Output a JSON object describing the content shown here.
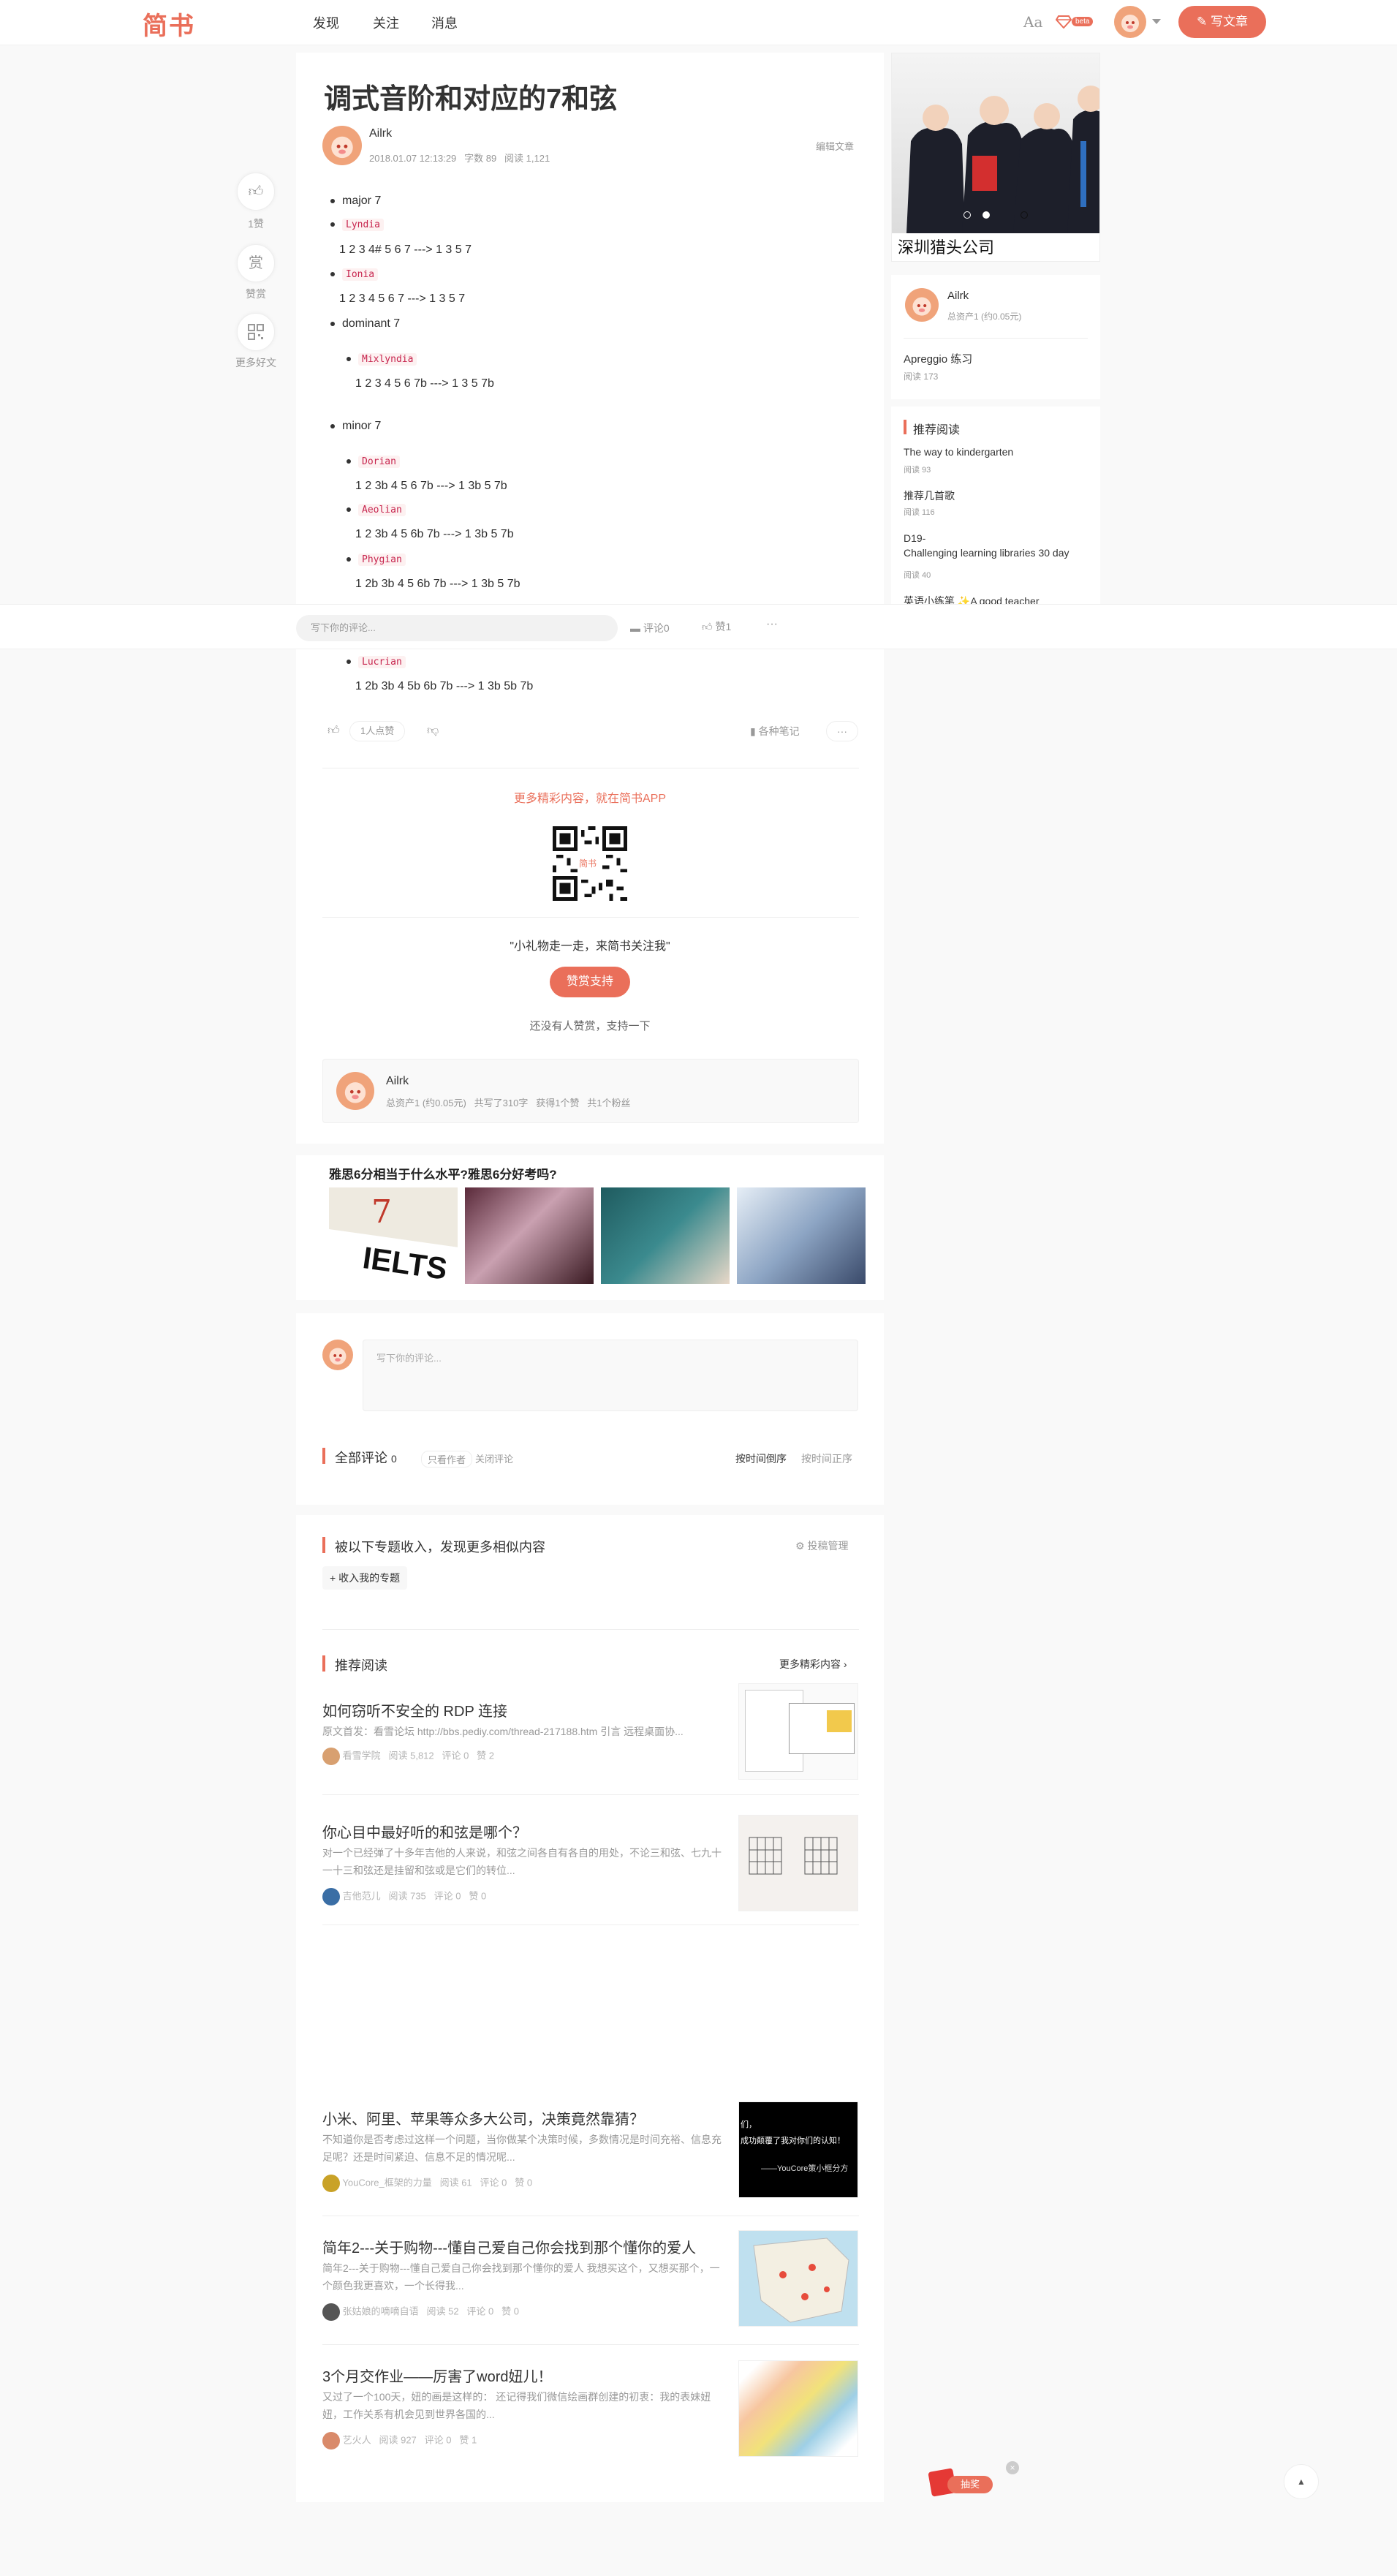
{
  "nav": {
    "logo": "简书",
    "links": [
      "发现",
      "关注",
      "消息"
    ],
    "font_toggle": "Aa",
    "beta": "beta",
    "write": "写文章"
  },
  "article": {
    "title": "调式音阶和对应的7和弦",
    "author": "Ailrk",
    "edit": "编辑文章",
    "date": "2018.01.07 12:13:29",
    "words": "字数 89",
    "reads": "阅读 1,121",
    "items": [
      {
        "bullet": "major 7"
      },
      {
        "code": "Lyndia",
        "text": "1 2 3 4# 5 6 7 ---> 1 3 5 7"
      },
      {
        "code": "Ionia",
        "text": "1 2 3 4 5 6 7 ---> 1 3 5 7"
      },
      {
        "bullet": "dominant 7"
      },
      {
        "code": "Mixlyndia",
        "text": "1 2 3 4 5 6 7b ---> 1 3 5 7b"
      },
      {
        "bullet": "minor 7"
      },
      {
        "code": "Dorian",
        "text": "1 2 3b 4 5 6 7b ---> 1 3b 5 7b"
      },
      {
        "code": "Aeolian",
        "text": "1 2 3b 4 5 6b 7b ---> 1 3b 5 7b"
      },
      {
        "code": "Phygian",
        "text": "1 2b 3b 4 5 6b 7b ---> 1 3b 5 7b"
      },
      {
        "code": "Lucrian",
        "text": "1 2b 3b 4 5b 6b 7b ---> 1 3b 5b 7b"
      }
    ]
  },
  "side_actions": {
    "like_count": "1赞",
    "reward_glyph": "赏",
    "reward": "赞赏",
    "more": "更多好文"
  },
  "comment_bar": {
    "placeholder": "写下你的评论...",
    "comments": "评论0",
    "likes": "赞1",
    "more": "···"
  },
  "like_row": {
    "liked": "1人点赞",
    "notebook": "各种笔记",
    "more": "···"
  },
  "app_promo": {
    "text": "更多精彩内容，就在简书APP",
    "qr_label": "简书"
  },
  "reward": {
    "slogan": "\"小礼物走一走，来简书关注我\"",
    "button": "赞赏支持",
    "note": "还没有人赞赏，支持一下"
  },
  "author_box": {
    "name": "Ailrk",
    "stats": [
      "总资产1 (约0.05元)",
      "共写了310字",
      "获得1个赞",
      "共1个粉丝"
    ]
  },
  "ad_strip": {
    "title": "雅思6分相当于什么水平?雅思6分好考吗?",
    "ielts_text": "IELTS"
  },
  "comments": {
    "placeholder": "写下你的评论...",
    "all": "全部评论",
    "count": "0",
    "only_author": "只看作者",
    "close": "关闭评论",
    "sort_desc": "按时间倒序",
    "sort_asc": "按时间正序"
  },
  "collections": {
    "title": "被以下专题收入，发现更多相似内容",
    "manage": "投稿管理",
    "add": "收入我的专题"
  },
  "recommend": {
    "title": "推荐阅读",
    "more": "更多精彩内容",
    "items": [
      {
        "title": "如何窃听不安全的 RDP 连接",
        "excerpt": "原文首发：看雪论坛 http://bbs.pediy.com/thread-217188.htm 引言 远程桌面协...",
        "author": "看雪学院",
        "reads": "阅读 5,812",
        "comments": "评论 0",
        "likes": "赞 2"
      },
      {
        "title": "你心目中最好听的和弦是哪个？",
        "excerpt": "对一个已经弹了十多年吉他的人来说，和弦之间各自有各自的用处，不论三和弦、七九十一十三和弦还是挂留和弦或是它们的转位...",
        "author": "吉他范儿",
        "reads": "阅读 735",
        "comments": "评论 0",
        "likes": "赞 0"
      },
      {
        "title": "小米、阿里、苹果等众多大公司，决策竟然靠猜？",
        "excerpt": "不知道你是否考虑过这样一个问题，当你做某个决策时候，多数情况是时间充裕、信息充足呢？还是时间紧迫、信息不足的情况呢...",
        "author": "YouCore_框架的力量",
        "reads": "阅读 61",
        "comments": "评论 0",
        "likes": "赞 0"
      },
      {
        "title": "简年2---关于购物---懂自己爱自己你会找到那个懂你的爱人",
        "excerpt": "简年2---关于购物---懂自己爱自己你会找到那个懂你的爱人 我想买这个，又想买那个，一个颜色我更喜欢，一个长得我...",
        "author": "张姑娘的嘀嘀自语",
        "reads": "阅读 52",
        "comments": "评论 0",
        "likes": "赞 0"
      },
      {
        "title": "3个月交作业——厉害了word妞儿！",
        "excerpt": "又过了一个100天，妞的画是这样的： 还记得我们微信绘画群创建的初衷：我的表妹妞妞，工作关系有机会见到世界各国的...",
        "author": "艺火人",
        "reads": "阅读 927",
        "comments": "评论 0",
        "likes": "赞 1"
      }
    ],
    "thumb3_lines": [
      "们，",
      "成功颠覆了我对你们的认知！",
      "——YouCore策小框分方"
    ]
  },
  "sidebar": {
    "ad_caption": "深圳猎头公司",
    "author": "Ailrk",
    "assets": "总资产1 (约0.05元)",
    "article": "Apreggio 练习",
    "article_reads": "阅读 173",
    "rec_title": "推荐阅读",
    "rec": [
      {
        "title": "The way to kindergarten",
        "reads": "阅读 93"
      },
      {
        "title": "推荐几首歌",
        "reads": "阅读 116"
      },
      {
        "title": "D19-\nChallenging learning libraries 30 day",
        "reads": "阅读 40"
      },
      {
        "title": "英语小练笔 ✨A good teacher",
        "reads": ""
      }
    ]
  },
  "float": {
    "lottery": "抽奖",
    "close": "×",
    "top": "▲"
  }
}
